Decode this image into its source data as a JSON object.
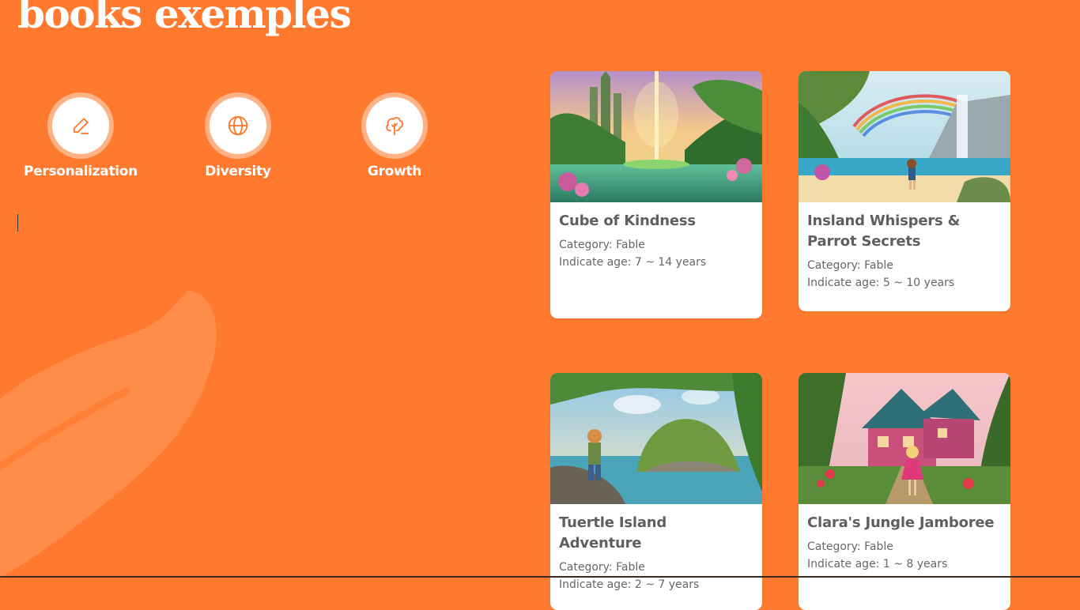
{
  "header": {
    "title": "books exemples"
  },
  "features": [
    {
      "label": "Personalization",
      "icon": "pencil-icon"
    },
    {
      "label": "Diversity",
      "icon": "globe-icon"
    },
    {
      "label": "Growth",
      "icon": "tree-icon"
    }
  ],
  "books": [
    {
      "title": "Cube of Kindness",
      "category": "Category: Fable",
      "age": "Indicate age: 7 ~ 14 years",
      "image": "fantasy-castle-waterfall-illustration"
    },
    {
      "title": "Insland Whispers & Parrot Secrets",
      "category": "Category: Fable",
      "age": "Indicate age: 5 ~ 10 years",
      "image": "tropical-beach-rainbow-boy-illustration"
    },
    {
      "title": "Tuertle Island Adventure",
      "category": "Category: Fable",
      "age": "Indicate age: 2 ~ 7 years",
      "image": "boy-looking-at-turtle-island-illustration"
    },
    {
      "title": "Clara's Jungle Jamboree",
      "category": "Category: Fable",
      "age": "Indicate age: 1 ~ 8 years",
      "image": "girl-jungle-house-illustration"
    }
  ],
  "colors": {
    "background": "#FF7A2F",
    "accent": "#FF7A2F",
    "card_title": "#5f5f5f",
    "card_meta": "#666666"
  }
}
